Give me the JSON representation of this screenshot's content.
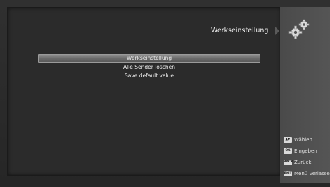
{
  "header": {
    "title": "Werkseinstellung",
    "icon": "gear-icon"
  },
  "menu": {
    "items": [
      {
        "label": "Werkseinstellung",
        "selected": true
      },
      {
        "label": "Alle Sender löschen",
        "selected": false
      },
      {
        "label": "Save default value",
        "selected": false
      }
    ]
  },
  "legend": [
    {
      "key_text": "▲▼",
      "icon": "up-down-key-icon",
      "label": "Wählen"
    },
    {
      "key_text": "OK",
      "icon": "ok-key-icon",
      "label": "Eingeben"
    },
    {
      "key_text": "BACK",
      "icon": "back-key-icon",
      "label": "Zurück"
    },
    {
      "key_text": "EXIT",
      "icon": "exit-key-icon",
      "label": "Menü Verlassen"
    }
  ]
}
